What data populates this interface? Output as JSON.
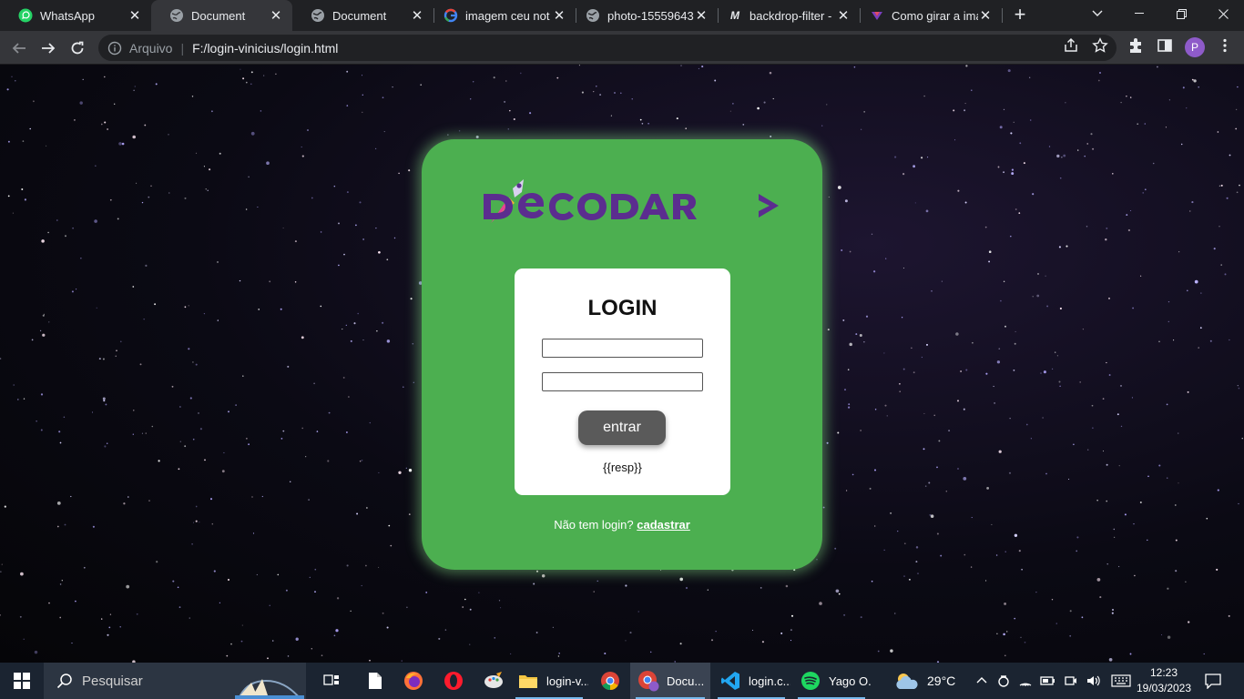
{
  "browser": {
    "tabs": [
      {
        "title": "WhatsApp",
        "icon": "whatsapp-icon",
        "active": false
      },
      {
        "title": "Document",
        "icon": "globe-icon",
        "active": true
      },
      {
        "title": "Document",
        "icon": "globe-icon",
        "active": false
      },
      {
        "title": "imagem ceu not",
        "icon": "google-icon",
        "active": false
      },
      {
        "title": "photo-15559643",
        "icon": "globe-icon",
        "active": false
      },
      {
        "title": "backdrop-filter -",
        "icon": "mdn-icon",
        "active": false
      },
      {
        "title": "Como girar a ima",
        "icon": "site-icon",
        "active": false
      }
    ],
    "address": {
      "scheme_label": "Arquivo",
      "url": "F:/login-vinicius/login.html"
    },
    "profile_initial": "P"
  },
  "page": {
    "logo_text": "DECODAR",
    "login_title": "LOGIN",
    "username_value": "",
    "password_value": "",
    "submit_label": "entrar",
    "response_text": "{{resp}}",
    "signup_prompt": "Não tem login?",
    "signup_link": "cadastrar"
  },
  "taskbar": {
    "search_placeholder": "Pesquisar",
    "apps": [
      {
        "name": "task-view",
        "label": ""
      },
      {
        "name": "file",
        "label": ""
      },
      {
        "name": "firefox",
        "label": ""
      },
      {
        "name": "opera",
        "label": ""
      },
      {
        "name": "paint",
        "label": ""
      },
      {
        "name": "explorer",
        "label": "login-v..."
      },
      {
        "name": "chrome",
        "label": ""
      },
      {
        "name": "chrome-profile",
        "label": "Docu..."
      },
      {
        "name": "vscode",
        "label": "login.c..."
      },
      {
        "name": "spotify",
        "label": "Yago O..."
      }
    ],
    "weather": "29°C",
    "time": "12:23",
    "date": "19/03/2023"
  },
  "colors": {
    "card_green": "#4caf50",
    "logo_purple": "#5b2d8f",
    "button_gray": "#5a5a5a"
  }
}
